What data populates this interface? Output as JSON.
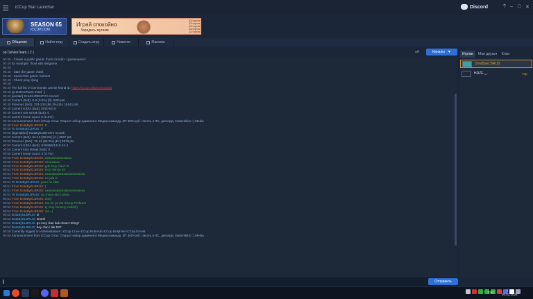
{
  "app": {
    "title": "iCCup Star Launcher"
  },
  "discord": {
    "label": "Discord"
  },
  "window_controls": {
    "help": "?",
    "minimize": "–",
    "maximize": "□",
    "close": "✕"
  },
  "banners": {
    "season": {
      "title": "SEASON 65",
      "subtitle": "ICCUP.COM"
    },
    "ad": {
      "line1": "Играй спокойно",
      "line2": "Зарядись мутами",
      "list": [
        "100 мутов",
        "100 мутов",
        "100 мутов",
        "100 мутов",
        "100 мутов"
      ]
    }
  },
  "tabs": [
    {
      "label": "Общение",
      "active": true
    },
    {
      "label": "Найти игру",
      "active": false
    },
    {
      "label": "Создать игру",
      "active": false
    },
    {
      "label": "Новости",
      "active": false
    },
    {
      "label": "Магазин",
      "active": false
    }
  ],
  "channel": {
    "name": "op DeNexTeam ( 2 )",
    "font_control": "aA",
    "channels_button": "Каналы",
    "channels_arrow": "▼"
  },
  "chat": [
    {
      "ts": "00:40",
      "cls": "c-sys",
      "text": "- Create a public game: /host <mode> <gamename>"
    },
    {
      "ts": "00:40",
      "cls": "c-sys",
      "text": "  for example: /host x6b testgame"
    },
    {
      "ts": "00:40",
      "cls": "c-sys",
      "text": ""
    },
    {
      "ts": "00:40",
      "cls": "c-sys",
      "text": "- Start the game: /start"
    },
    {
      "ts": "00:40",
      "cls": "c-sys",
      "text": "- Cancel the game: /unhost"
    },
    {
      "ts": "00:40",
      "cls": "c-sys",
      "text": "- Check ping: /ping"
    },
    {
      "ts": "00:40",
      "cls": "c-sys",
      "text": ""
    },
    {
      "ts": "00:40",
      "cls": "c-sys",
      "text": "The full list of commands can be found at:",
      "link": "https://iccup.com/commands"
    },
    {
      "ts": "00:40",
      "cls": "c-sys",
      "text": "op DeNexTeam motd: :)"
    },
    {
      "ts": "00:48",
      "cls": "c-sys",
      "text": "[unstan] SHUKURENTO's record:"
    },
    {
      "ts": "00:48",
      "cls": "c-sys",
      "text": "Current (5x5): 0-0 (0.0%) [0] 1000 pts"
    },
    {
      "ts": "00:48",
      "cls": "c-sys",
      "text": "Previous (5x5): 274-214 (56.1%) [0-] 19141 pts"
    },
    {
      "ts": "00:48",
      "cls": "c-sys",
      "text": "Current K/D/A (5x5): 0/0/0 K0.0"
    },
    {
      "ts": "00:48",
      "cls": "c-sys",
      "text": "Current win streak (5x5): 0"
    },
    {
      "ts": "00:48",
      "cls": "c-sys",
      "text": "Current leave count: 0 (0.0%)"
    },
    {
      "ts": "00:48",
      "cls": "c-sys",
      "text": "Announcement from iCCup Crow: Открыт набор админов в Медиа команду. ЗП 300+руб. писать в ЛС, дискорд: mistersklizc :) Media"
    },
    {
      "ts": "00:49",
      "cls": "c-from",
      "text": "From DotaByELBRUS:",
      "msg": "D"
    },
    {
      "ts": "00:50",
      "cls": "c-to",
      "text": "To DotaByELBRUS:",
      "msg": "D"
    },
    {
      "ts": "00:50",
      "cls": "c-sys",
      "text": "[sigmablue] DotaByELBRUS's record:"
    },
    {
      "ts": "00:50",
      "cls": "c-sys",
      "text": "Current (5x5): 64-43 (59.8%) [A-] 9667 pts"
    },
    {
      "ts": "00:50",
      "cls": "c-sys",
      "text": "Previous (5x5): 76-41 (65.0%) [B+] 9578 pts"
    },
    {
      "ts": "00:50",
      "cls": "c-sys",
      "text": "Current K/D/A (5x5): 978/656/1218 K2.4"
    },
    {
      "ts": "00:50",
      "cls": "c-sys",
      "text": "Current loss streak (5x5): 5"
    },
    {
      "ts": "00:50",
      "cls": "c-sys",
      "text": "Current leave count: 4 (3.7%)"
    },
    {
      "ts": "00:50",
      "cls": "c-from",
      "text": "From DotaByELBRUS:",
      "msg": "ахахахахахахахах"
    },
    {
      "ts": "00:50",
      "cls": "c-from",
      "text": "From DotaByELBRUS:",
      "msg": "хахахахах"
    },
    {
      "ts": "00:50",
      "cls": "c-from",
      "text": "From DotaByELBRUS:",
      "msg": "gde tvoy clan? D"
    },
    {
      "ts": "00:51",
      "cls": "c-from",
      "text": "From DotaByELBRUS:",
      "msg": "tvoy clan je lol"
    },
    {
      "ts": "00:51",
      "cls": "c-from",
      "text": "From DotaByELBRUS:",
      "msg": "ахахахахахахахахахахахах"
    },
    {
      "ts": "00:51",
      "cls": "c-from",
      "text": "From DotaByELBRUS:",
      "msg": "ne jalo D"
    },
    {
      "ts": "00:51",
      "cls": "c-to",
      "text": "To DotaByELBRUS:",
      "msg": "posu ne klan"
    },
    {
      "ts": "00:51",
      "cls": "c-from",
      "text": "From DotaByELBRUS:",
      "msg": ")"
    },
    {
      "ts": "00:51",
      "cls": "c-from",
      "text": "From DotaByELBRUS:",
      "msg": "ахахахахахахахахахахахах"
    },
    {
      "ts": "00:51",
      "cls": "c-to",
      "text": "To DotaByELBRUS:",
      "msg": "ya znayu eto ti oleta"
    },
    {
      "ts": "00:51",
      "cls": "c-from",
      "text": "From DotaByELBRUS:",
      "msg": "davy"
    },
    {
      "ts": "00:52",
      "cls": "c-from",
      "text": "From DotaByELBRUS:",
      "msg": "eto ne ya eto iCCup Prokuror"
    },
    {
      "ts": "00:52",
      "cls": "c-from",
      "text": "From DotaByELBRUS:",
      "msg": "ty moy konsery maklin)"
    },
    {
      "ts": "00:52",
      "cls": "c-from",
      "text": "From DotaByELBRUS:",
      "msg": "via =)"
    },
    {
      "ts": "00:52",
      "cls": "c-nick",
      "text": "DotaByELBRUS:",
      "msg": "D",
      "msg_cls": "c-white"
    },
    {
      "ts": "00:52",
      "cls": "c-nick",
      "text": "DotaByELBRUS:",
      "msg": "smetri",
      "msg_cls": "c-white"
    },
    {
      "ts": "00:52",
      "cls": "c-nick",
      "text": "DotaByELBRUS:",
      "msg": "go moy clan kak doner reting?",
      "msg_cls": "c-white"
    },
    {
      "ts": "00:52",
      "cls": "c-nick",
      "text": "DotaByELBRUS:",
      "msg": "bey clan i tak RIP",
      "msg_cls": "c-white"
    },
    {
      "ts": "00:58",
      "cls": "c-sys",
      "text": "Currently logged on Administrators: iCCup.Crow iCCup.Nuborub iCCup.Delphine iCCup.Ernest"
    },
    {
      "ts": "00:58",
      "cls": "c-sys",
      "text": "Announcement from iCCup Crow: Открыт набор админов в Медиа команду. ЗП 300+руб. писать в ЛС, дискорд: mistersklizc :) Media"
    }
  ],
  "input": {
    "send_label": "Отправить"
  },
  "right_panel": {
    "tabs": [
      {
        "label": "Игроки",
        "active": true
      },
      {
        "label": "Мои друзья",
        "active": false
      },
      {
        "label": "Клан",
        "active": false
      }
    ],
    "players": [
      {
        "name": "DotaByELBRUS",
        "rank": "",
        "color": "#d8a030",
        "selected": true,
        "flag": "#3aa0a0"
      },
      {
        "name": "HRZE-_-",
        "rank": "Top-",
        "color": "#d8e0ec",
        "selected": false,
        "flag": "#222a36"
      }
    ]
  },
  "taskbar": {
    "lang": "ENG",
    "time": "1:05",
    "date": "04.03.2026"
  }
}
